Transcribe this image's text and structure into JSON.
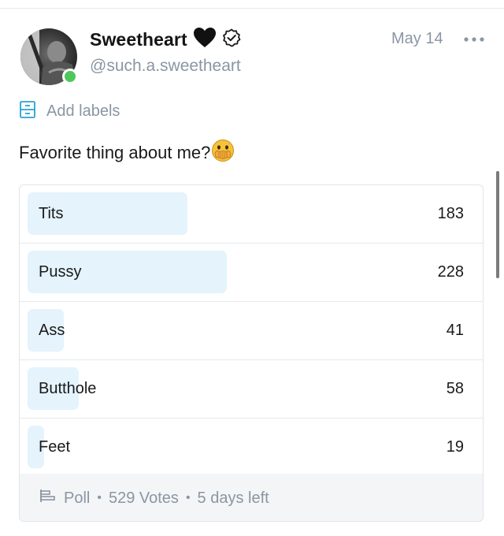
{
  "post": {
    "author_name": "Sweetheart",
    "author_handle": "@such.a.sweetheart",
    "date": "May 14",
    "add_labels": "Add labels",
    "text": "Favorite thing about me?",
    "emoji": "face-with-hand-over-mouth",
    "status": "online",
    "verified": true
  },
  "poll": {
    "options": [
      {
        "label": "Tits",
        "votes": "183",
        "share": 0.346
      },
      {
        "label": "Pussy",
        "votes": "228",
        "share": 0.431
      },
      {
        "label": "Ass",
        "votes": "41",
        "share": 0.078
      },
      {
        "label": "Butthole",
        "votes": "58",
        "share": 0.11
      },
      {
        "label": "Feet",
        "votes": "19",
        "share": 0.036
      }
    ],
    "footer": {
      "type_label": "Poll",
      "votes_label": "529 Votes",
      "time_left": "5 days left",
      "separator": "•"
    }
  },
  "colors": {
    "bar_fill": "#e4f3fc",
    "muted_text": "#8a96a3",
    "online": "#4cc85a",
    "accent": "#00aff0"
  },
  "icons": [
    "black-heart-icon",
    "verified-badge-icon",
    "more-icon",
    "labels-icon",
    "poll-icon"
  ]
}
